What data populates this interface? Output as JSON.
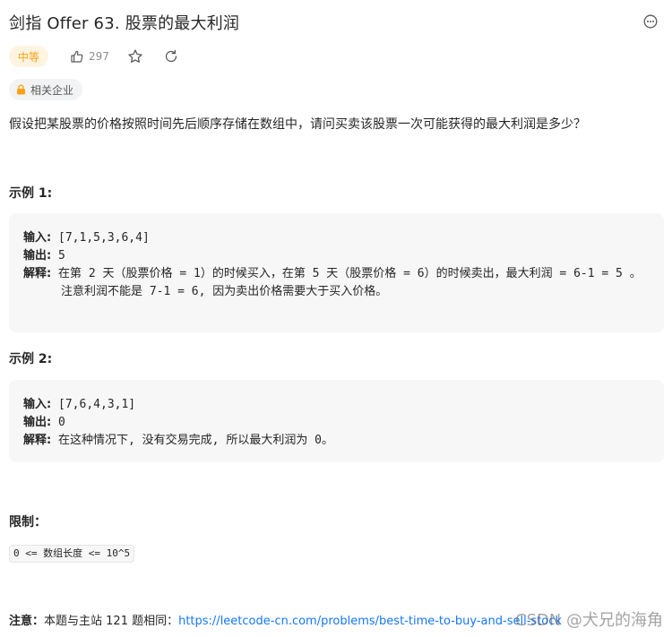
{
  "header": {
    "title": "剑指 Offer 63. 股票的最大利润"
  },
  "meta": {
    "difficulty": "中等",
    "likes": "297",
    "company_tag": "相关企业"
  },
  "description": "假设把某股票的价格按照时间先后顺序存储在数组中，请问买卖该股票一次可能获得的最大利润是多少？",
  "examples": [
    {
      "title": "示例 1:",
      "input_label": "输入:",
      "input_value": " [7,1,5,3,6,4]",
      "output_label": "输出:",
      "output_value": " 5",
      "explain_label": "解释:",
      "explain_value": " 在第 2 天（股票价格 = 1）的时候买入，在第 5 天（股票价格 = 6）的时候卖出，最大利润 = 6-1 = 5 。",
      "explain_extra": "注意利润不能是 7-1 = 6, 因为卖出价格需要大于买入价格。"
    },
    {
      "title": "示例 2:",
      "input_label": "输入:",
      "input_value": " [7,6,4,3,1]",
      "output_label": "输出:",
      "output_value": " 0",
      "explain_label": "解释:",
      "explain_value": " 在这种情况下, 没有交易完成, 所以最大利润为 0。"
    }
  ],
  "constraints": {
    "title": "限制：",
    "items": [
      "0 <= 数组长度 <= 10^5"
    ]
  },
  "note": {
    "label": "注意：",
    "text": "本题与主站 121 题相同：",
    "link": "https://leetcode-cn.com/problems/best-time-to-buy-and-sell-stock"
  },
  "watermark": "CSDN @犬兄的海角",
  "colors": {
    "difficulty_text": "#ffa116",
    "difficulty_bg": "#fff4e0",
    "link": "#1677ff",
    "lock_icon": "#ffa116"
  }
}
